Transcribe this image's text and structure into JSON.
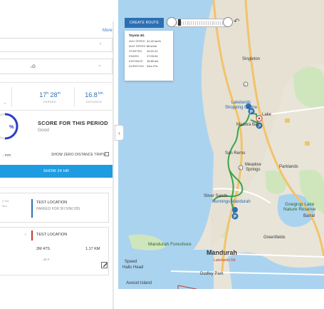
{
  "colors": {
    "accent": "#2d6fb3",
    "button_blue": "#1d9ce2",
    "route_green": "#3aa34a",
    "water": "#aad3f0",
    "land": "#e8e4d8",
    "park": "#cfe6bd",
    "location_bar_blue": "#2d6fb3",
    "location_bar_red": "#c0392b"
  },
  "panel": {
    "more_link": "More",
    "select_1": {
      "value": "",
      "chevron": "›"
    },
    "select_2": {
      "value": "₊G",
      "chevron": "⌄"
    },
    "stats": [
      {
        "value_main": "17",
        "value_sup1": "h",
        "value_mid": " 28",
        "value_sup2": "m",
        "label": "PARKED"
      },
      {
        "value_main": "16.8",
        "value_sup1": " km",
        "value_mid": "",
        "value_sup2": "",
        "label": "DISTANCE"
      }
    ],
    "stat_left_fragment": "s",
    "score": {
      "ring_value": "%",
      "title": "SCORE FOR THIS PERIOD",
      "subtitle": "Good"
    },
    "filter": {
      "left_text": "; mm",
      "zero_distance_label": "SHOW ZERO DISTANCE TRIPS"
    },
    "show_24h_button": "SHOW 24 HR",
    "locations": [
      {
        "left_text_1": "0 Sta",
        "left_text_2": "5tra",
        "title": "TEST LOCATION",
        "subtitle": "PARKED FOR 5H 50M 28S"
      },
      {
        "arrow": "‹",
        "title": "TEST LOCATION",
        "duration": "2M 47S",
        "distance": "1.17 KM",
        "extra": "₊K A"
      }
    ]
  },
  "map": {
    "toolbar": {
      "create_route_label": "CREATE ROUTE",
      "back_icon": "↶"
    },
    "trip_info": {
      "title": "Toyota 4G",
      "rows": [
        {
          "key": "AVG SPEED",
          "value": "41.22 km/h"
        },
        {
          "key": "MAX SPEED",
          "value": "86 km/h"
        },
        {
          "key": "STARTED",
          "value": "10:21:21"
        },
        {
          "key": "ENDED",
          "value": "17:03:04"
        },
        {
          "key": "DISTANCE",
          "value": "16.80 km"
        },
        {
          "key": "DURATION",
          "value": "24m 27s"
        }
      ]
    },
    "labels": {
      "singleton": "Singleton",
      "lakelands": "Lakelands\nShopping Centre",
      "lakelands_short": "Lake",
      "madora_bay": "Madora Bay",
      "san_remo": "San Remo",
      "meadow_springs": "Meadow\nSprings",
      "parklands": "Parklands",
      "silver_sands": "Silver Sands",
      "bunnings": "Bunnings Mandurah",
      "goegrup": "Goegrup Lake\nNature Reserve",
      "greenfields": "Greenfields",
      "mandurah_foreshore": "Mandurah Foreshore",
      "mandurah": "Mandurah",
      "dudley_park": "Dudley Park",
      "avocet_island": "Avocet Island",
      "bardall": "Barral",
      "lakelands_road": "Lakelands Rd",
      "hall_head": "Halls Head",
      "speed": "Speed",
      "road_1": "1",
      "road_2": "2"
    }
  }
}
